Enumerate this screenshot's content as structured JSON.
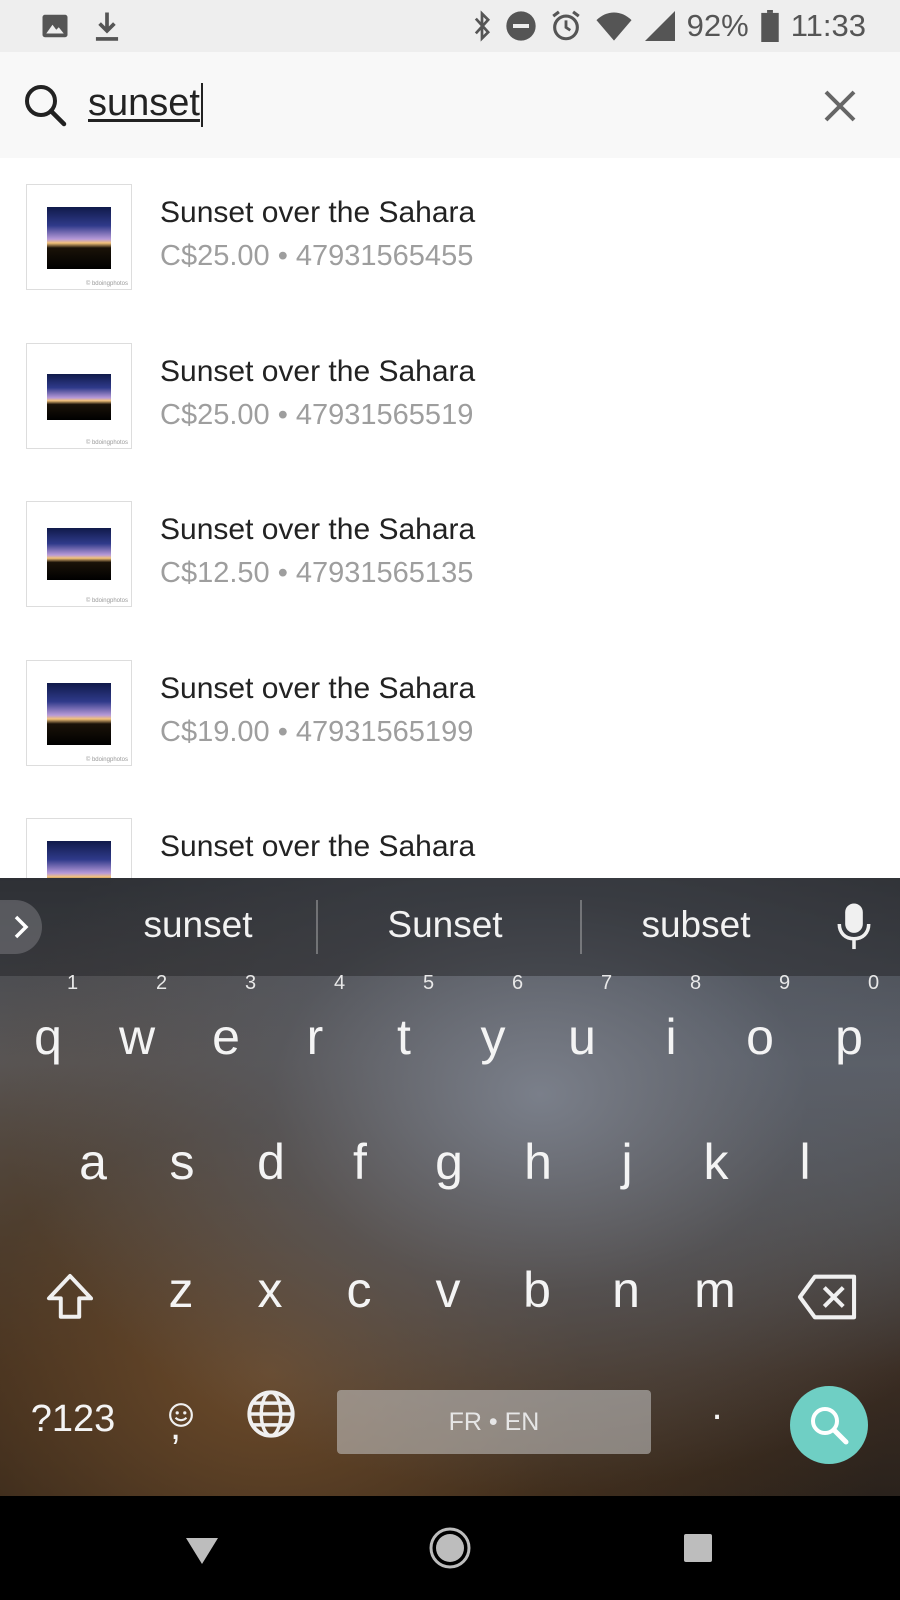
{
  "status_bar": {
    "battery": "92%",
    "time": "11:33",
    "left_icons": [
      "image-icon",
      "download-icon"
    ],
    "right_icons": [
      "bluetooth-icon",
      "dnd-icon",
      "alarm-icon",
      "wifi-icon",
      "signal-icon",
      "battery-icon"
    ]
  },
  "search": {
    "query": "sunset",
    "icon": "search-icon",
    "clear_icon": "close-icon"
  },
  "results": [
    {
      "title": "Sunset over the Sahara",
      "subtitle": "C$25.00 • 47931565455",
      "credit": "© bdoingphotos"
    },
    {
      "title": "Sunset over the Sahara",
      "subtitle": "C$25.00 • 47931565519",
      "credit": "© bdoingphotos"
    },
    {
      "title": "Sunset over the Sahara",
      "subtitle": "C$12.50 • 47931565135",
      "credit": "© bdoingphotos"
    },
    {
      "title": "Sunset over the Sahara",
      "subtitle": "C$19.00 • 47931565199",
      "credit": "© bdoingphotos"
    },
    {
      "title": "Sunset over the Sahara",
      "subtitle": "",
      "credit": ""
    }
  ],
  "keyboard": {
    "suggestions": [
      "sunset",
      "Sunset",
      "subset"
    ],
    "row1": [
      "q",
      "w",
      "e",
      "r",
      "t",
      "y",
      "u",
      "i",
      "o",
      "p"
    ],
    "row1_hints": [
      "1",
      "2",
      "3",
      "4",
      "5",
      "6",
      "7",
      "8",
      "9",
      "0"
    ],
    "row2": [
      "a",
      "s",
      "d",
      "f",
      "g",
      "h",
      "j",
      "k",
      "l"
    ],
    "row3": [
      "z",
      "x",
      "c",
      "v",
      "b",
      "n",
      "m"
    ],
    "symbols_label": "?123",
    "comma_label": ",",
    "period_label": ".",
    "space_label": "FR • EN",
    "accent_color": "#6fcfc4"
  },
  "nav": {
    "icons": [
      "back-icon",
      "home-icon",
      "recents-icon"
    ]
  }
}
